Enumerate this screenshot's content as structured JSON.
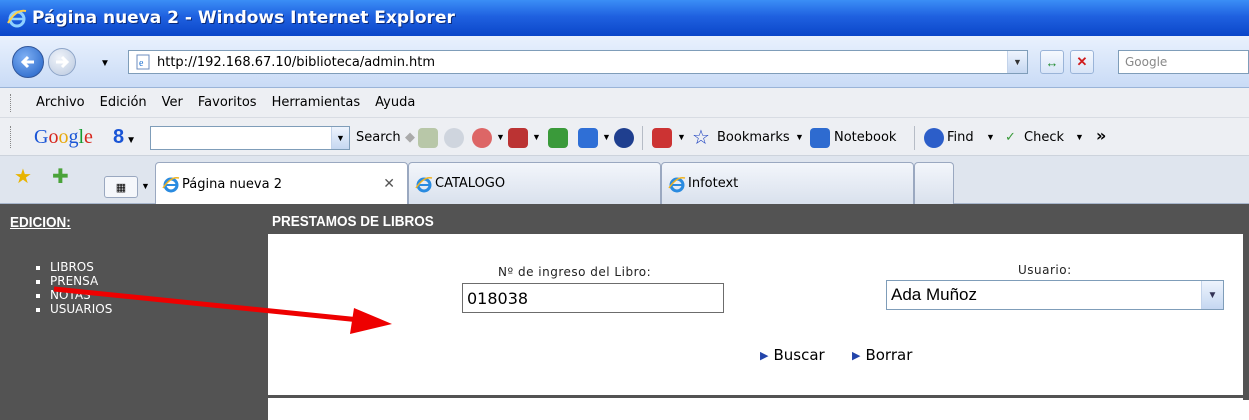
{
  "window": {
    "title": "Página nueva 2 - Windows Internet Explorer"
  },
  "address": {
    "url": "http://192.168.67.10/biblioteca/admin.htm",
    "search_placeholder": "Google"
  },
  "menu": {
    "items": [
      "Archivo",
      "Edición",
      "Ver",
      "Favoritos",
      "Herramientas",
      "Ayuda"
    ]
  },
  "google_toolbar": {
    "search_label": "Search",
    "bookmarks_label": "Bookmarks",
    "notebook_label": "Notebook",
    "find_label": "Find",
    "check_label": "Check",
    "more": "»"
  },
  "tabs": [
    {
      "label": "Página nueva 2",
      "active": true
    },
    {
      "label": "CATALOGO",
      "active": false
    },
    {
      "label": "Infotext",
      "active": false
    }
  ],
  "sidebar": {
    "heading": "EDICION:",
    "items": [
      "LIBROS",
      "PRENSA",
      "NOTAS",
      "USUARIOS"
    ]
  },
  "main": {
    "section_title": "PRESTAMOS DE LIBROS",
    "ingreso_label": "Nº de ingreso del Libro:",
    "ingreso_value": "018038",
    "usuario_label": "Usuario:",
    "usuario_value": "Ada Muñoz",
    "buscar_label": "Buscar",
    "borrar_label": "Borrar"
  },
  "colors": {
    "titlebar": "#1f61e0",
    "panel": "#535353",
    "arrow": "#ee0000"
  }
}
